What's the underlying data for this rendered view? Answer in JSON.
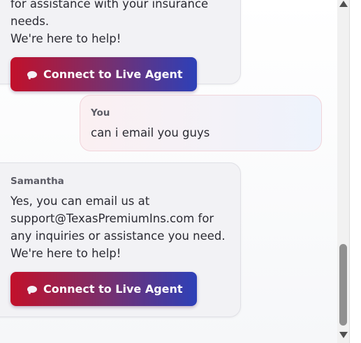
{
  "messages": {
    "first": {
      "line1": "for assistance with your insurance needs.",
      "line2": "We're here to help!",
      "button_label": "Connect to Live Agent"
    },
    "user": {
      "sender": "You",
      "text": "can i email you guys"
    },
    "second": {
      "sender": "Samantha",
      "text": "Yes, you can email us at support@TexasPremiumIns.com for any inquiries or assistance you need. We're here to help!",
      "button_label": "Connect to Live Agent"
    }
  },
  "icons": {
    "button_icon": "chat-bubble-icon",
    "scroll_up": "scroll-up-arrow-icon",
    "scroll_down": "scroll-down-arrow-icon"
  },
  "colors": {
    "button_gradient_start": "#c2102a",
    "button_gradient_end": "#2d40b8",
    "agent_bubble": "#f2f2f5",
    "user_bubble_border": "#f1d4da"
  }
}
